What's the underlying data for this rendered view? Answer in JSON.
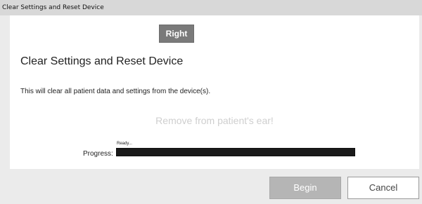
{
  "window": {
    "title": "Clear Settings and Reset Device"
  },
  "side_button": {
    "label": "Right"
  },
  "main": {
    "heading": "Clear Settings and Reset Device",
    "description": "This will clear all patient data and settings from the device(s).",
    "instruction": "Remove from patient's ear!"
  },
  "progress": {
    "status": "Ready...",
    "label": "Progress:",
    "value_percent": 0
  },
  "footer": {
    "begin_label": "Begin",
    "cancel_label": "Cancel"
  },
  "colors": {
    "side_button_bg": "#7a7a7a",
    "begin_disabled_bg": "#b5b5b5",
    "instruction_text": "#cfcfcf",
    "progress_track": "#1a1a1a"
  }
}
